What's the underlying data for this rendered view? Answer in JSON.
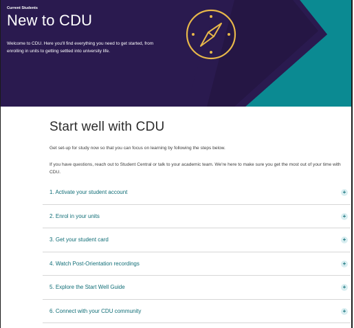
{
  "hero": {
    "eyebrow": "Current Students",
    "title": "New to CDU",
    "description": "Welcome to CDU. Here you'll find everything you need to get started, from enrolling in units to getting settled into university life."
  },
  "colors": {
    "hero_background": "#2a1a4f",
    "teal": "#0b8a92",
    "accent_gold": "#e8b84a",
    "link": "#0f6d76"
  },
  "icons": {
    "hero_icon": "compass-icon",
    "expand_icon": "plus-icon"
  },
  "main": {
    "title": "Start well with CDU",
    "intro": "Get set-up for study now so that you can focus on learning by following the steps below.",
    "intro2": "If you have questions, reach out to Student Central or talk to your academic team. We're here to make sure you get the most out of your time with CDU.",
    "steps": [
      {
        "label": "1. Activate your student account",
        "icon": "+"
      },
      {
        "label": "2. Enrol in your units",
        "icon": "+"
      },
      {
        "label": "3. Get your student card",
        "icon": "+"
      },
      {
        "label": "4. Watch Post-Orientation recordings",
        "icon": "+"
      },
      {
        "label": "5. Explore the Start Well Guide",
        "icon": "+"
      },
      {
        "label": "6. Connect with your CDU community",
        "icon": "+"
      }
    ]
  }
}
